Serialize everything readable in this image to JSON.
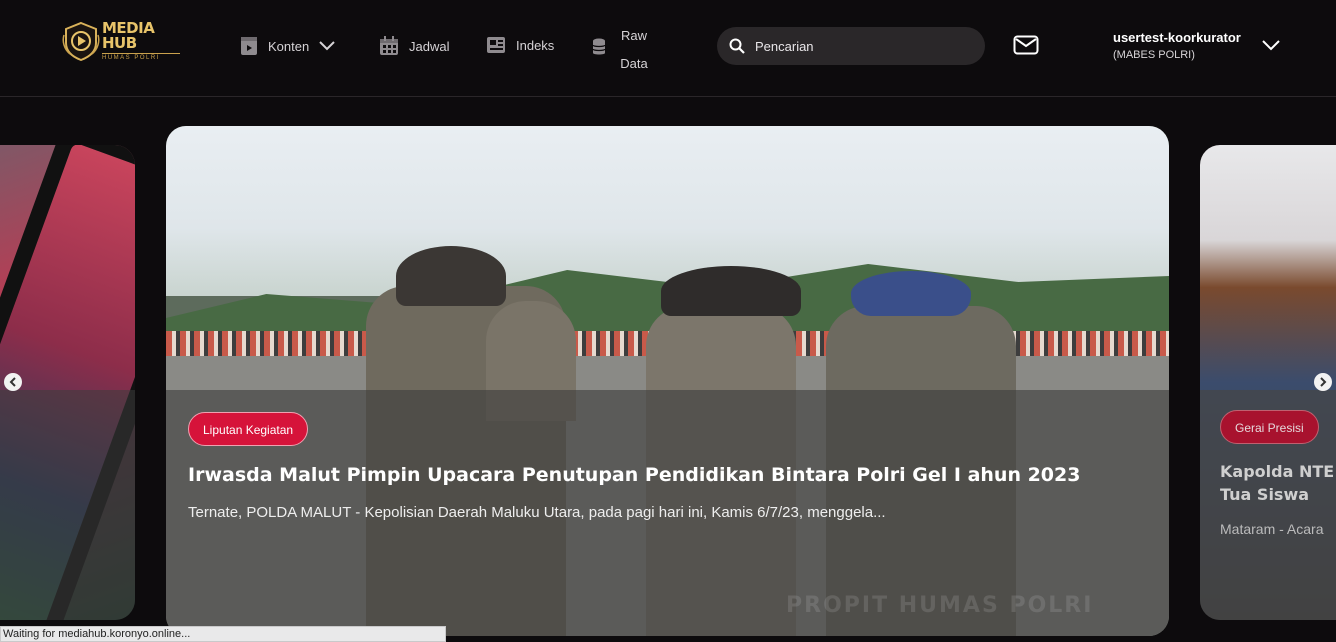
{
  "brand": {
    "name": "MEDIA HUB",
    "sub": "HUMAS POLRI"
  },
  "nav": {
    "konten": "Konten",
    "jadwal": "Jadwal",
    "indeks": "Indeks",
    "raw_line1": "Raw",
    "raw_line2": "Data"
  },
  "search": {
    "placeholder": "Pencarian"
  },
  "user": {
    "name": "usertest-koorkurator",
    "org": "(MABES POLRI)"
  },
  "slides": {
    "main": {
      "badge": "Liputan Kegiatan",
      "title": "Irwasda Malut Pimpin Upacara Penutupan Pendidikan Bintara Polri Gel I ahun 2023",
      "excerpt": "Ternate, POLDA MALUT - Kepolisian Daerah Maluku Utara, pada pagi hari ini, Kamis 6/7/23, menggela...",
      "watermark": "PROPIT HUMAS POLRI"
    },
    "right": {
      "badge": "Gerai Presisi",
      "title_line1": "Kapolda NTE",
      "title_line2": "Tua Siswa",
      "excerpt": "Mataram - Acara"
    }
  },
  "status_bar": "Waiting for mediahub.koronyo.online...",
  "colors": {
    "background": "#0d0b0d",
    "badge": "#d6133a",
    "brand_gold": "#e8c46a",
    "search_bg": "#2a2729"
  }
}
